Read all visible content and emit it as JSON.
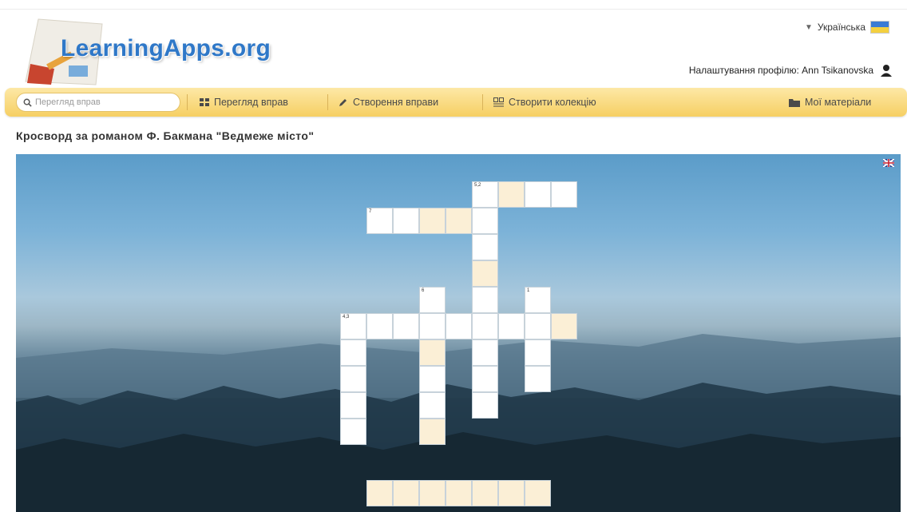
{
  "header": {
    "logo_text": "LearningApps.org",
    "language": "Українська",
    "profile": "Налаштування профілю: Ann Tsikanovska"
  },
  "colors": {
    "logo_blue": "#2f78c8",
    "toolbar_top": "#fde8a6",
    "toolbar_bottom": "#f6cf63",
    "cell_highlight": "#fbefd6"
  },
  "toolbar": {
    "search_placeholder": "Перегляд вправ",
    "browse_label": "Перегляд вправ",
    "create_label": "Створення вправи",
    "collection_label": "Створити колекцію",
    "materials_label": "Мої матеріали"
  },
  "page": {
    "title": "Кросворд за романом Ф. Бакмана \"Ведмеже місто\""
  },
  "crossword": {
    "clue_numbers": [
      "5,2",
      "7",
      "6",
      "1",
      "4,3"
    ],
    "cells": [
      {
        "r": 0,
        "c": 5,
        "num": "5,2"
      },
      {
        "r": 0,
        "c": 6,
        "hl": true
      },
      {
        "r": 0,
        "c": 7
      },
      {
        "r": 0,
        "c": 8
      },
      {
        "r": 1,
        "c": 1,
        "num": "7"
      },
      {
        "r": 1,
        "c": 2
      },
      {
        "r": 1,
        "c": 3,
        "hl": true
      },
      {
        "r": 1,
        "c": 4,
        "hl": true
      },
      {
        "r": 1,
        "c": 5
      },
      {
        "r": 2,
        "c": 5
      },
      {
        "r": 3,
        "c": 5,
        "hl": true
      },
      {
        "r": 4,
        "c": 3,
        "num": "6"
      },
      {
        "r": 4,
        "c": 5
      },
      {
        "r": 4,
        "c": 7,
        "num": "1"
      },
      {
        "r": 5,
        "c": 0,
        "num": "4,3"
      },
      {
        "r": 5,
        "c": 1
      },
      {
        "r": 5,
        "c": 2
      },
      {
        "r": 5,
        "c": 3
      },
      {
        "r": 5,
        "c": 4
      },
      {
        "r": 5,
        "c": 5
      },
      {
        "r": 5,
        "c": 6
      },
      {
        "r": 5,
        "c": 7
      },
      {
        "r": 5,
        "c": 8,
        "hl": true
      },
      {
        "r": 6,
        "c": 0
      },
      {
        "r": 6,
        "c": 3,
        "hl": true
      },
      {
        "r": 6,
        "c": 5
      },
      {
        "r": 6,
        "c": 7
      },
      {
        "r": 7,
        "c": 0
      },
      {
        "r": 7,
        "c": 3
      },
      {
        "r": 7,
        "c": 5
      },
      {
        "r": 7,
        "c": 7
      },
      {
        "r": 8,
        "c": 0
      },
      {
        "r": 8,
        "c": 3
      },
      {
        "r": 8,
        "c": 5
      },
      {
        "r": 9,
        "c": 0
      },
      {
        "r": 9,
        "c": 3,
        "hl": true
      }
    ],
    "answer_row_count": 7
  }
}
